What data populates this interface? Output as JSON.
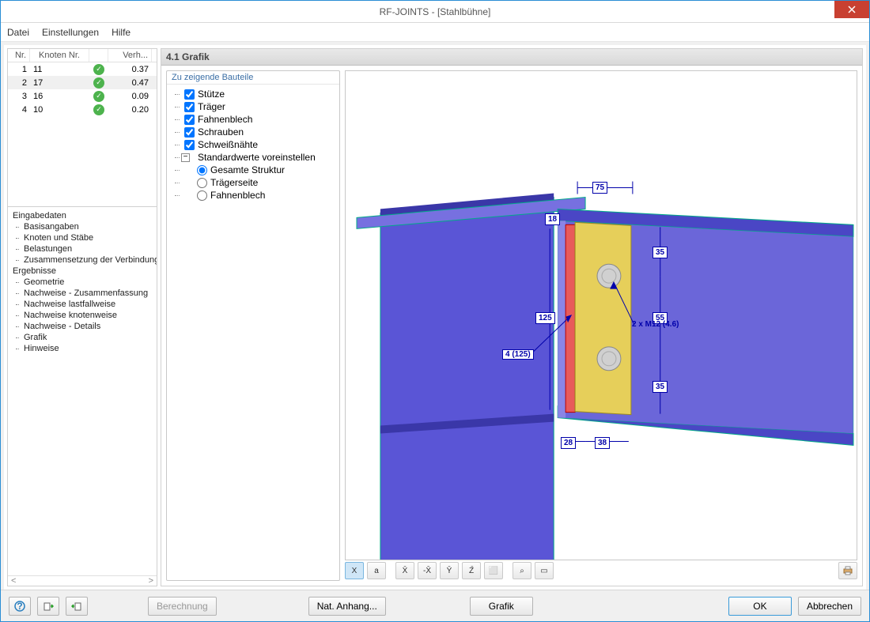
{
  "window": {
    "title": "RF-JOINTS - [Stahlbühne]"
  },
  "menu": {
    "file": "Datei",
    "settings": "Einstellungen",
    "help": "Hilfe"
  },
  "table": {
    "headers": {
      "nr": "Nr.",
      "knoten": "Knoten Nr.",
      "verh": "Verh..."
    },
    "rows": [
      {
        "nr": "1",
        "knoten": "11",
        "verh": "0.37"
      },
      {
        "nr": "2",
        "knoten": "17",
        "verh": "0.47"
      },
      {
        "nr": "3",
        "knoten": "16",
        "verh": "0.09"
      },
      {
        "nr": "4",
        "knoten": "10",
        "verh": "0.20"
      }
    ]
  },
  "tree": {
    "input_title": "Eingabedaten",
    "input_items": [
      "Basisangaben",
      "Knoten und Stäbe",
      "Belastungen",
      "Zusammensetzung der Verbindung"
    ],
    "results_title": "Ergebnisse",
    "result_items": [
      "Geometrie",
      "Nachweise - Zusammenfassung",
      "Nachweise lastfallweise",
      "Nachweise knotenweise",
      "Nachweise - Details",
      "Grafik",
      "Hinweise"
    ]
  },
  "section_title": "4.1 Grafik",
  "options": {
    "title": "Zu zeigende Bauteile",
    "checks": [
      "Stütze",
      "Träger",
      "Fahnenblech",
      "Schrauben",
      "Schweißnähte"
    ],
    "presets_label": "Standardwerte voreinstellen",
    "radios": [
      "Gesamte Struktur",
      "Trägerseite",
      "Fahnenblech"
    ]
  },
  "graphic": {
    "dim_top": "75",
    "dim_18": "18",
    "dim_125": "125",
    "dim_35a": "35",
    "dim_55": "55",
    "dim_35b": "35",
    "dim_28": "28",
    "dim_38": "38",
    "plate_label": "4 (125)",
    "bolt_label": "2 x M12 (4.6)"
  },
  "view_tools": [
    "X",
    "a",
    "X̄",
    "-X̄",
    "Ȳ",
    "Z̄",
    "⬜",
    "⌕",
    "▭"
  ],
  "bottom": {
    "calc": "Berechnung",
    "nat": "Nat. Anhang...",
    "grafik": "Grafik",
    "ok": "OK",
    "cancel": "Abbrechen"
  }
}
